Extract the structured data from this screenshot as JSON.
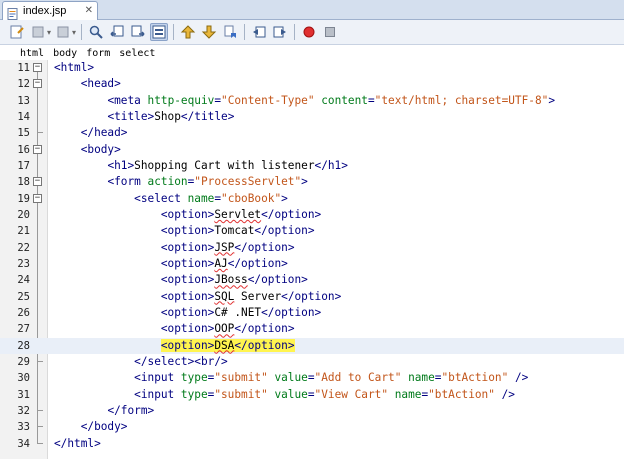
{
  "tab": {
    "title": "index.jsp",
    "close_glyph": "✕"
  },
  "toolbar": {
    "buttons": [
      "last-edit-icon",
      "back-icon",
      "forward-icon",
      "find-selection-icon",
      "find-previous-icon",
      "find-next-icon",
      "toggle-highlight-search-icon",
      "previous-bookmark-icon",
      "next-bookmark-icon",
      "toggle-bookmark-icon",
      "shift-left-icon",
      "shift-right-icon",
      "start-macro-icon",
      "stop-macro-icon"
    ],
    "dropdown_glyph": "▾"
  },
  "breadcrumb": [
    "html",
    "body",
    "form",
    "select"
  ],
  "colors": {
    "tag": "#000080",
    "attribute": "#007a1a",
    "value": "#c2551a",
    "highlight": "#fff44f"
  },
  "editor": {
    "current_line": 28,
    "lines": [
      {
        "n": "11",
        "fold": "open",
        "code": "<html>"
      },
      {
        "n": "12",
        "fold": "open",
        "code": "    <head>"
      },
      {
        "n": "13",
        "fold": "",
        "code": "        <meta http-equiv=\"Content-Type\" content=\"text/html; charset=UTF-8\">"
      },
      {
        "n": "14",
        "fold": "",
        "code": "        <title>Shop</title>"
      },
      {
        "n": "15",
        "fold": "end",
        "code": "    </head>"
      },
      {
        "n": "16",
        "fold": "open",
        "code": "    <body>"
      },
      {
        "n": "17",
        "fold": "",
        "code": "        <h1>Shopping Cart with listener</h1>"
      },
      {
        "n": "18",
        "fold": "open",
        "code": "        <form action=\"ProcessServlet\">"
      },
      {
        "n": "19",
        "fold": "open",
        "code": "            <select name=\"cboBook\">"
      },
      {
        "n": "20",
        "fold": "",
        "code": "                <option>Servlet</option>"
      },
      {
        "n": "21",
        "fold": "",
        "code": "                <option>Tomcat</option>"
      },
      {
        "n": "22",
        "fold": "",
        "code": "                <option>JSP</option>"
      },
      {
        "n": "23",
        "fold": "",
        "code": "                <option>AJ</option>"
      },
      {
        "n": "24",
        "fold": "",
        "code": "                <option>JBoss</option>"
      },
      {
        "n": "25",
        "fold": "",
        "code": "                <option>SQL Server</option>"
      },
      {
        "n": "26",
        "fold": "",
        "code": "                <option>C# .NET</option>"
      },
      {
        "n": "27",
        "fold": "",
        "code": "                <option>OOP</option>"
      },
      {
        "n": "28",
        "fold": "",
        "code": "                <option>DSA</option>"
      },
      {
        "n": "29",
        "fold": "end",
        "code": "            </select><br/>"
      },
      {
        "n": "30",
        "fold": "",
        "code": "            <input type=\"submit\" value=\"Add to Cart\" name=\"btAction\" />"
      },
      {
        "n": "31",
        "fold": "",
        "code": "            <input type=\"submit\" value=\"View Cart\" name=\"btAction\" />"
      },
      {
        "n": "32",
        "fold": "end",
        "code": "        </form>"
      },
      {
        "n": "33",
        "fold": "end",
        "code": "    </body>"
      },
      {
        "n": "34",
        "fold": "end",
        "code": "</html>"
      }
    ],
    "squiggled_words": [
      "Servlet",
      "JSP",
      "AJ",
      "JBoss",
      "SQL",
      "OOP",
      "DSA"
    ],
    "highlighted_text": "<option>DSA</option>"
  }
}
